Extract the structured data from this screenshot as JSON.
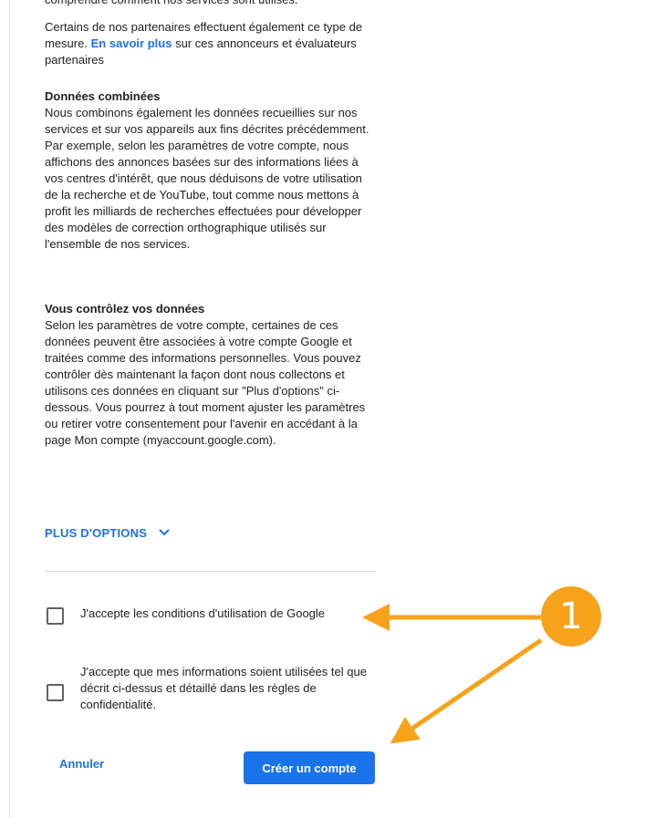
{
  "top_cut_text": "comprendre comment nos services sont utilisés.",
  "partners": {
    "text_before": "Certains de nos partenaires effectuent également ce type de mesure. ",
    "link": "En savoir plus",
    "text_after": " sur ces annonceurs et évaluateurs partenaires"
  },
  "sections": [
    {
      "title": "Données combinées",
      "body": "Nous combinons également les données recueillies sur nos services et sur vos appareils aux fins décrites précédemment. Par exemple, selon les paramètres de votre compte, nous affichons des annonces basées sur des informations liées à vos centres d'intérêt, que nous déduisons de votre utilisation de la recherche et de YouTube, tout comme nous mettons à profit les milliards de recherches effectuées pour développer des modèles de correction orthographique utilisés sur l'ensemble de nos services."
    },
    {
      "title": "Vous contrôlez vos données",
      "body": "Selon les paramètres de votre compte, certaines de ces données peuvent être associées à votre compte Google et traitées comme des informations personnelles. Vous pouvez contrôler dès maintenant la façon dont nous collectons et utilisons ces données en cliquant sur \"Plus d'options\" ci-dessous. Vous pourrez à tout moment ajuster les paramètres ou retirer votre consentement pour l'avenir en accédant à la page Mon compte (myaccount.google.com)."
    }
  ],
  "more_options_label": "PLUS D'OPTIONS",
  "checkboxes": [
    {
      "label": "J'accepte les conditions d'utilisation de Google"
    },
    {
      "label": "J'accepte que mes informations soient utilisées tel que décrit ci-dessus et détaillé dans les règles de confidentialité."
    }
  ],
  "buttons": {
    "cancel": "Annuler",
    "create": "Créer un compte"
  },
  "annotation_number": "1",
  "colors": {
    "link": "#1a73e8",
    "primary_button": "#1a73e8",
    "annotation": "#f7a21b"
  }
}
